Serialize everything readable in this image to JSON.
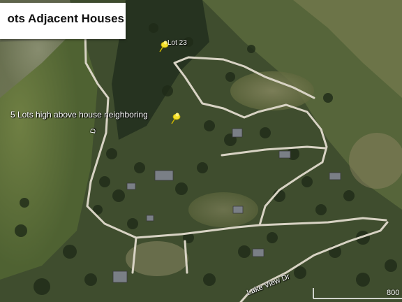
{
  "title": "ots Adjacent Houses",
  "labels": {
    "lot23": "Lot 23",
    "five_lots": "5 Lots high above house neighboring",
    "road_vertical": "D",
    "road_lakeview": "Lake View Dr"
  },
  "scale": {
    "label": "800"
  },
  "icons": {
    "pin": "yellow-pushpin-icon"
  },
  "colors": {
    "forest_dark": "#2c3a22",
    "meadow": "#5c6e3a",
    "road": "#d8d3c4",
    "pin_yellow": "#f5e12a",
    "title_bg": "#ffffff"
  }
}
